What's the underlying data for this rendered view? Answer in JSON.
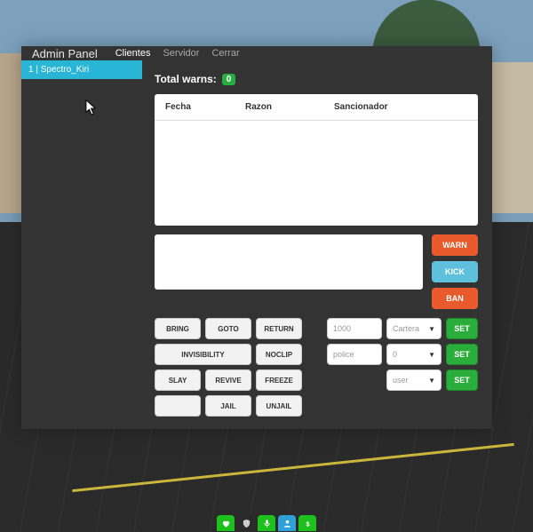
{
  "header": {
    "title": "Admin Panel",
    "tabs": {
      "clientes": "Clientes",
      "servidor": "Servidor",
      "cerrar": "Cerrar"
    }
  },
  "sidebar": {
    "players": [
      {
        "label": "1 | Spectro_Kiri"
      }
    ]
  },
  "warns": {
    "label": "Total warns:",
    "count": "0",
    "columns": {
      "fecha": "Fecha",
      "razon": "Razon",
      "sancionador": "Sancionador"
    }
  },
  "actions": {
    "warn": "WARN",
    "kick": "KICK",
    "ban": "BAN"
  },
  "teleport": {
    "bring": "BRING",
    "goto": "GOTO",
    "return": "RETURN",
    "invisibility": "INVISIBILITY",
    "noclip": "NOCLIP",
    "slay": "SLAY",
    "revive": "REVIVE",
    "freeze": "FREEZE",
    "blank": "",
    "jail": "JAIL",
    "unjail": "UNJAIL"
  },
  "setters": {
    "row1": {
      "input": "1000",
      "select": "Cartera",
      "button": "SET"
    },
    "row2": {
      "input": "police",
      "select": "0",
      "button": "SET"
    },
    "row3": {
      "select": "user",
      "button": "SET"
    }
  },
  "hud": {
    "icons": [
      "heart-icon",
      "shield-icon",
      "mic-icon",
      "id-icon",
      "money-icon"
    ]
  }
}
